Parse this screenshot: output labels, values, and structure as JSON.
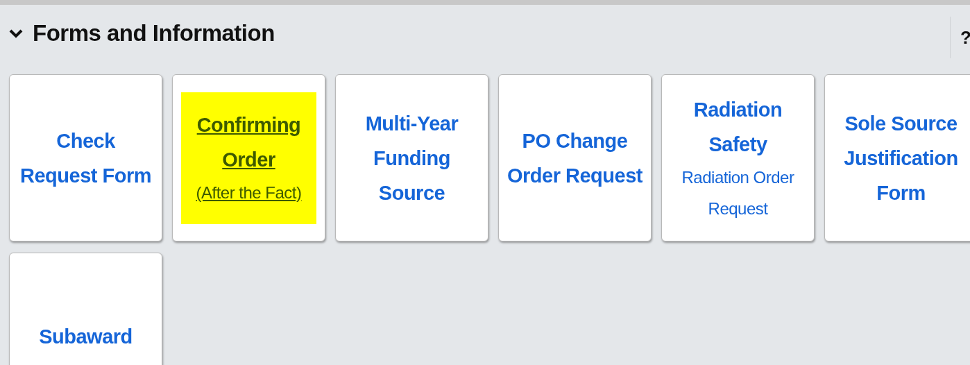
{
  "section": {
    "title": "Forms and Information",
    "expanded": true,
    "help": "?"
  },
  "tiles": [
    {
      "title": "Check Request Form",
      "highlighted": false
    },
    {
      "title": "Confirming Order",
      "subtitle": "(After the Fact)",
      "highlighted": true
    },
    {
      "title": "Multi-Year Funding Source",
      "highlighted": false
    },
    {
      "title": "PO Change Order Request",
      "highlighted": false
    },
    {
      "title": "Radiation Safety",
      "subtitle": "Radiation Order Request",
      "highlighted": false
    },
    {
      "title": "Sole Source Justification Form",
      "highlighted": false
    },
    {
      "title": "Subaward",
      "highlighted": false
    }
  ]
}
